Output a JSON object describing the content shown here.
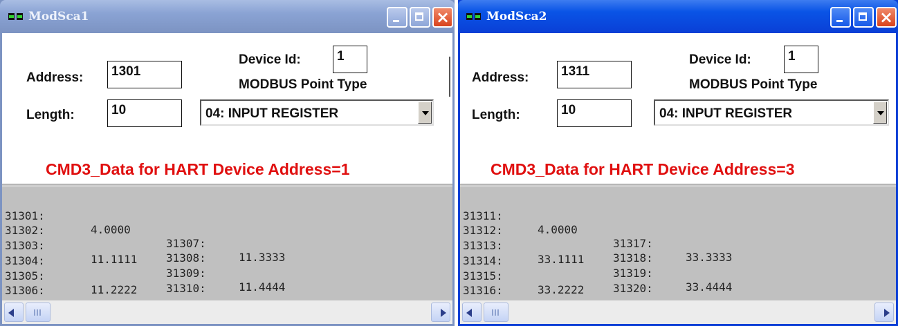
{
  "windows": [
    {
      "title": "ModSca1",
      "address_label": "Address:",
      "address_value": "1301",
      "length_label": "Length:",
      "length_value": "10",
      "device_id_label": "Device Id:",
      "device_id_value": "1",
      "point_type_label": "MODBUS Point Type",
      "point_type_value": "04: INPUT REGISTER",
      "heading": "CMD3_Data for HART Device Address=1",
      "registers": [
        {
          "addr": "31301:",
          "value": "4.0000"
        },
        {
          "addr": "31302:",
          "value": ""
        },
        {
          "addr": "31303:",
          "value": "11.1111"
        },
        {
          "addr": "31304:",
          "value": ""
        },
        {
          "addr": "31305:",
          "value": "11.2222"
        },
        {
          "addr": "31306:",
          "value": ""
        },
        {
          "addr": "31307:",
          "value": "11.3333"
        },
        {
          "addr": "31308:",
          "value": ""
        },
        {
          "addr": "31309:",
          "value": "11.4444"
        },
        {
          "addr": "31310:",
          "value": ""
        }
      ]
    },
    {
      "title": "ModSca2",
      "address_label": "Address:",
      "address_value": "1311",
      "length_label": "Length:",
      "length_value": "10",
      "device_id_label": "Device Id:",
      "device_id_value": "1",
      "point_type_label": "MODBUS Point Type",
      "point_type_value": "04: INPUT REGISTER",
      "heading": "CMD3_Data for HART Device Address=3",
      "registers": [
        {
          "addr": "31311:",
          "value": "4.0000"
        },
        {
          "addr": "31312:",
          "value": ""
        },
        {
          "addr": "31313:",
          "value": "33.1111"
        },
        {
          "addr": "31314:",
          "value": ""
        },
        {
          "addr": "31315:",
          "value": "33.2222"
        },
        {
          "addr": "31316:",
          "value": ""
        },
        {
          "addr": "31317:",
          "value": "33.3333"
        },
        {
          "addr": "31318:",
          "value": ""
        },
        {
          "addr": "31319:",
          "value": "33.4444"
        },
        {
          "addr": "31320:",
          "value": ""
        }
      ]
    }
  ],
  "colors": {
    "inactive_titlebar": "#7c93c2",
    "active_titlebar": "#0a3fd6",
    "heading_text": "#e01010",
    "data_background": "#c0c0c0"
  }
}
